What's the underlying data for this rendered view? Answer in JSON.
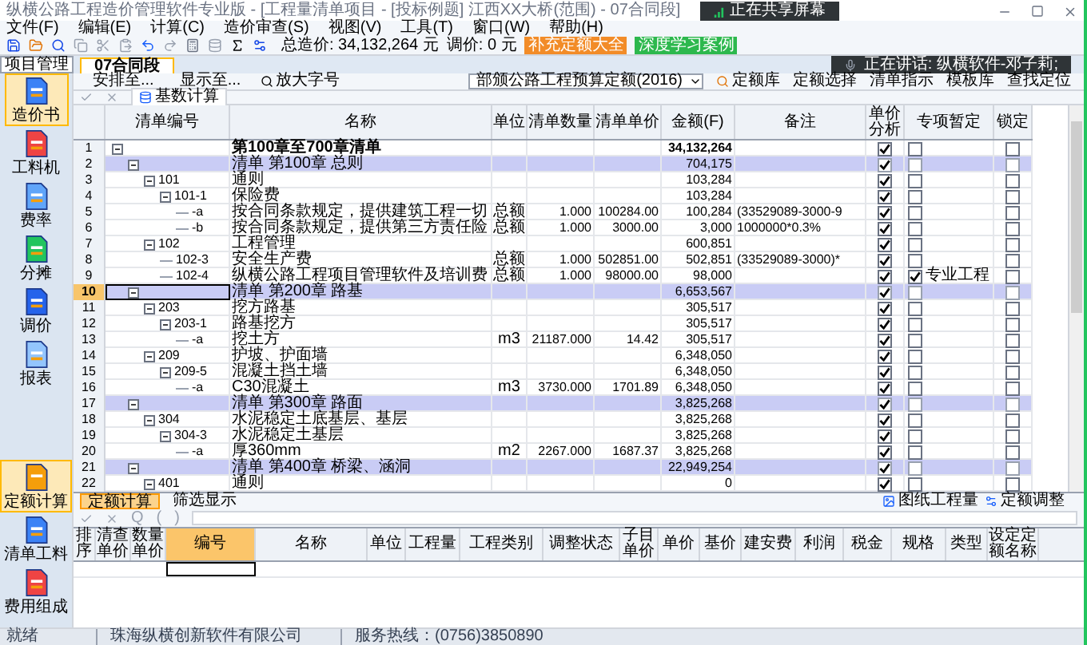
{
  "window": {
    "title": "纵横公路工程造价管理软件专业版 - [工程量清单项目 - [投标例题] 江西XX大桥(范围) - 07合同段]"
  },
  "screen_share_badge": "正在共享屏幕",
  "speaking_notice": "正在讲话: 纵横软件-邓子莉;",
  "menu": [
    "文件(F)",
    "编辑(E)",
    "计算(C)",
    "造价审查(S)",
    "视图(V)",
    "工具(T)",
    "窗口(W)",
    "帮助(H)"
  ],
  "toolbar": {
    "total_label": "总造价: 34,132,264 元",
    "adjust_label": "调价: 0 元",
    "tags": [
      {
        "text": "补充定额大全",
        "color": "#f28c28"
      },
      {
        "text": "深度学习案例",
        "color": "#2db84d"
      }
    ]
  },
  "project_button": "项目管理",
  "nav_top": [
    {
      "label": "造价书",
      "selected": true
    },
    {
      "label": "工料机",
      "selected": false
    },
    {
      "label": "费率",
      "selected": false
    },
    {
      "label": "分摊",
      "selected": false
    },
    {
      "label": "调价",
      "selected": false
    },
    {
      "label": "报表",
      "selected": false
    }
  ],
  "nav_bottom": [
    {
      "label": "定额计算",
      "selected": true
    },
    {
      "label": "清单工料",
      "selected": false
    },
    {
      "label": "费用组成",
      "selected": false
    }
  ],
  "doc_tabs": [
    {
      "label": "07合同段",
      "selected": true
    }
  ],
  "view_toolbar": {
    "buttons": [
      "安排至...",
      "显示至..."
    ],
    "zoom_button": "放大字号",
    "quota_select": "部颁公路工程预算定额(2016)",
    "quota_library": "定额库",
    "right_buttons": [
      "定额选择",
      "清单指示",
      "模板库",
      "查找定位"
    ]
  },
  "edit_bar": {
    "base_calc": "基数计算"
  },
  "bill_table": {
    "columns": [
      "清单编号",
      "名称",
      "单位",
      "清单数量",
      "清单单价",
      "金额(F)",
      "备注",
      "单价分析",
      "专项暂定",
      "锁定"
    ],
    "rows": [
      {
        "no": "1",
        "kind": "total",
        "code": "",
        "name": "第100章至700章清单",
        "amount": "34,132,264",
        "analysis": true,
        "special": false,
        "locked": false,
        "selected": false,
        "expanded": true,
        "children": [
          {
            "no": "2",
            "kind": "chapter",
            "name": "清单 第100章  总则",
            "amount": "704,175",
            "analysis": true,
            "special": false,
            "locked": false,
            "selected": false,
            "expanded": true,
            "children": [
              {
                "no": "3",
                "kind": "item",
                "code": "101",
                "name": "通则",
                "amount": "103,284",
                "analysis": true,
                "special": false,
                "locked": false,
                "selected": false,
                "expanded": true,
                "children": [
                  {
                    "no": "4",
                    "kind": "item",
                    "code": "101-1",
                    "name": "保险费",
                    "amount": "103,284",
                    "analysis": true,
                    "special": false,
                    "locked": false,
                    "selected": false,
                    "expanded": true,
                    "children": [
                      {
                        "no": "5",
                        "kind": "item",
                        "code": "-a",
                        "name": "按合同条款规定，提供建筑工程一切",
                        "unit": "总额",
                        "qty": "1.000",
                        "price": "100284.00",
                        "amount": "100,284",
                        "note": "(33529089-3000-9",
                        "analysis": true,
                        "special": false,
                        "locked": false,
                        "selected": false
                      },
                      {
                        "no": "6",
                        "kind": "item",
                        "code": "-b",
                        "name": "按合同条款规定，提供第三方责任险",
                        "unit": "总额",
                        "qty": "1.000",
                        "price": "3000.00",
                        "amount": "3,000",
                        "note": "1000000*0.3%",
                        "analysis": true,
                        "special": false,
                        "locked": false,
                        "selected": false
                      }
                    ]
                  }
                ]
              },
              {
                "no": "7",
                "kind": "item",
                "code": "102",
                "name": "工程管理",
                "amount": "600,851",
                "analysis": true,
                "special": false,
                "locked": false,
                "selected": false,
                "expanded": true,
                "children": [
                  {
                    "no": "8",
                    "kind": "item",
                    "code": "102-3",
                    "name": "安全生产费",
                    "unit": "总额",
                    "qty": "1.000",
                    "price": "502851.00",
                    "amount": "502,851",
                    "note": "(33529089-3000)*",
                    "analysis": true,
                    "special": false,
                    "locked": false,
                    "selected": false
                  },
                  {
                    "no": "9",
                    "kind": "item",
                    "code": "102-4",
                    "name": "纵横公路工程项目管理软件及培训费",
                    "unit": "总额",
                    "qty": "1.000",
                    "price": "98000.00",
                    "amount": "98,000",
                    "analysis": true,
                    "special": true,
                    "special_note": "专业工程",
                    "locked": false,
                    "selected": false
                  }
                ]
              }
            ]
          },
          {
            "no": "10",
            "kind": "chapter",
            "name": "清单 第200章  路基",
            "amount": "6,653,567",
            "analysis": true,
            "special": false,
            "locked": false,
            "selected": true,
            "expanded": true,
            "children": [
              {
                "no": "11",
                "kind": "item",
                "code": "203",
                "name": "挖方路基",
                "amount": "305,517",
                "analysis": true,
                "special": false,
                "locked": false,
                "selected": false,
                "expanded": true,
                "children": [
                  {
                    "no": "12",
                    "kind": "item",
                    "code": "203-1",
                    "name": "路基挖方",
                    "amount": "305,517",
                    "analysis": true,
                    "special": false,
                    "locked": false,
                    "selected": false,
                    "expanded": true,
                    "children": [
                      {
                        "no": "13",
                        "kind": "item",
                        "code": "-a",
                        "name": "挖土方",
                        "unit": "m3",
                        "qty": "21187.000",
                        "price": "14.42",
                        "amount": "305,517",
                        "analysis": true,
                        "special": false,
                        "locked": false,
                        "selected": false
                      }
                    ]
                  }
                ]
              },
              {
                "no": "14",
                "kind": "item",
                "code": "209",
                "name": "护坡、护面墙",
                "amount": "6,348,050",
                "analysis": true,
                "special": false,
                "locked": false,
                "selected": false,
                "expanded": true,
                "children": [
                  {
                    "no": "15",
                    "kind": "item",
                    "code": "209-5",
                    "name": "混凝土挡土墙",
                    "amount": "6,348,050",
                    "analysis": true,
                    "special": false,
                    "locked": false,
                    "selected": false,
                    "expanded": true,
                    "children": [
                      {
                        "no": "16",
                        "kind": "item",
                        "code": "-a",
                        "name": "C30混凝土",
                        "unit": "m3",
                        "qty": "3730.000",
                        "price": "1701.89",
                        "amount": "6,348,050",
                        "analysis": true,
                        "special": false,
                        "locked": false,
                        "selected": false
                      }
                    ]
                  }
                ]
              }
            ]
          },
          {
            "no": "17",
            "kind": "chapter",
            "name": "清单 第300章  路面",
            "amount": "3,825,268",
            "analysis": true,
            "special": false,
            "locked": false,
            "selected": false,
            "expanded": true,
            "children": [
              {
                "no": "18",
                "kind": "item",
                "code": "304",
                "name": "水泥稳定土底基层、基层",
                "amount": "3,825,268",
                "analysis": true,
                "special": false,
                "locked": false,
                "selected": false,
                "expanded": true,
                "children": [
                  {
                    "no": "19",
                    "kind": "item",
                    "code": "304-3",
                    "name": "水泥稳定土基层",
                    "amount": "3,825,268",
                    "analysis": true,
                    "special": false,
                    "locked": false,
                    "selected": false,
                    "expanded": true,
                    "children": [
                      {
                        "no": "20",
                        "kind": "item",
                        "code": "-a",
                        "name": "厚360mm",
                        "unit": "m2",
                        "qty": "2267.000",
                        "price": "1687.37",
                        "amount": "3,825,268",
                        "analysis": true,
                        "special": false,
                        "locked": false,
                        "selected": false
                      }
                    ]
                  }
                ]
              }
            ]
          },
          {
            "no": "21",
            "kind": "chapter",
            "name": "清单 第400章  桥梁、涵洞",
            "amount": "22,949,254",
            "analysis": true,
            "special": false,
            "locked": false,
            "selected": false,
            "expanded": true,
            "children": [
              {
                "no": "22",
                "kind": "item",
                "code": "401",
                "name": "通则",
                "amount": "0",
                "analysis": true,
                "special": false,
                "locked": false,
                "selected": false,
                "expanded": true
              }
            ]
          }
        ]
      }
    ]
  },
  "bill_actions": [
    "图纸工程量",
    "定额调整"
  ],
  "bottom_tabs": [
    {
      "label": "定额计算",
      "selected": true
    },
    {
      "label": "筛选显示",
      "selected": false
    }
  ],
  "formula_bar": {
    "symbols": [
      "Q",
      "(",
      ")"
    ]
  },
  "quota_table": {
    "columns": [
      "排序",
      "清查单价",
      "数量单价",
      "编号",
      "名称",
      "单位",
      "工程量",
      "工程类别",
      "调整状态",
      "子目单价",
      "单价",
      "基价",
      "建安费",
      "利润",
      "税金",
      "规格",
      "类型",
      "设定定额名称"
    ]
  },
  "status_bar": [
    "就绪",
    "珠海纵横创新软件有限公司",
    "服务热线：(0756)3850890"
  ]
}
